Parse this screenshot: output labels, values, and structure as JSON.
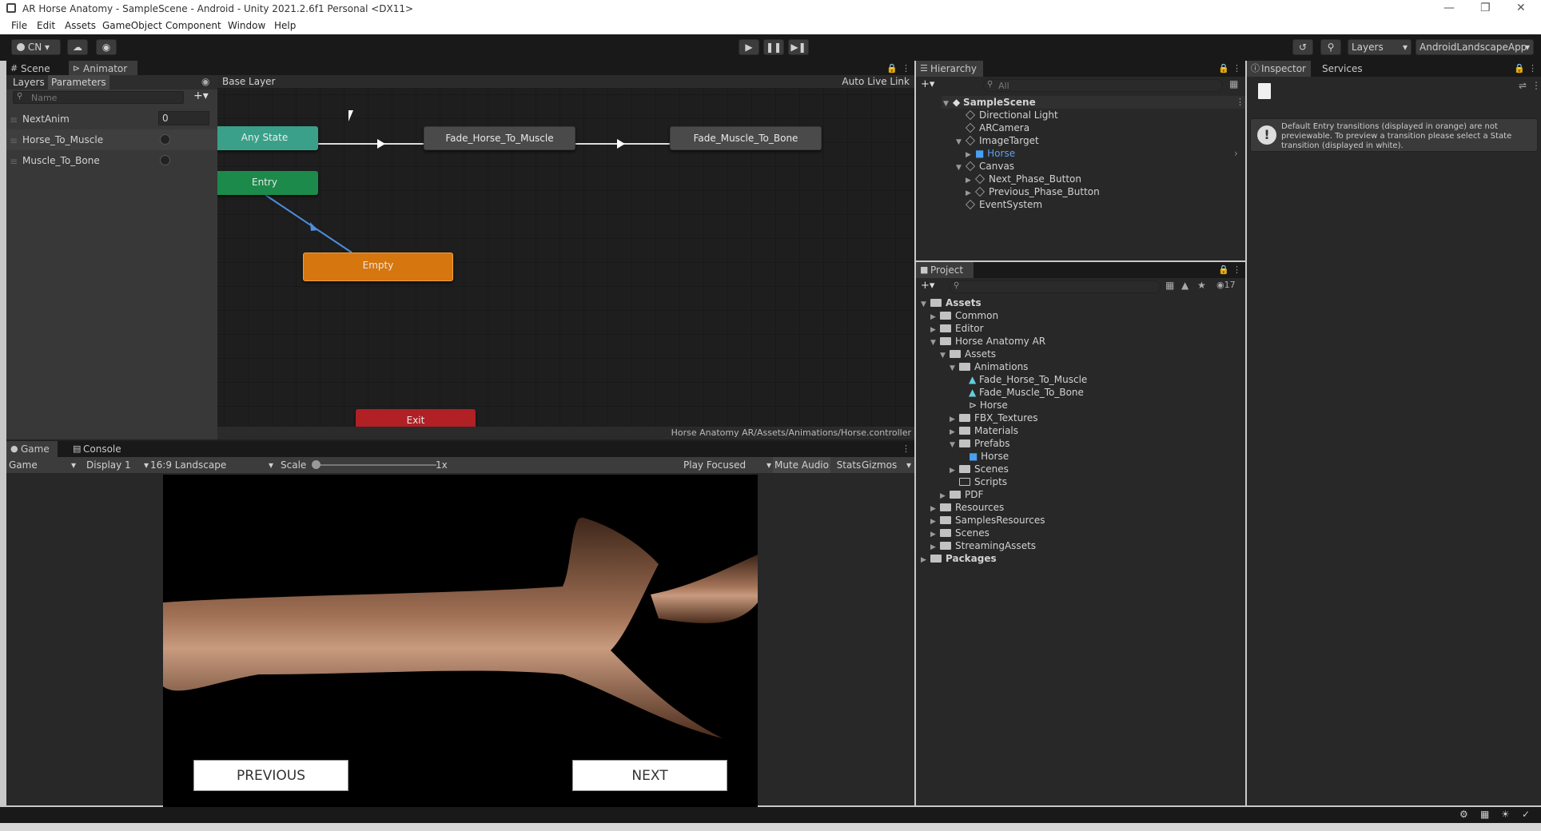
{
  "window": {
    "title": "AR Horse Anatomy - SampleScene - Android - Unity 2021.2.6f1 Personal <DX11>"
  },
  "menu": [
    "File",
    "Edit",
    "Assets",
    "GameObject",
    "Component",
    "Window",
    "Help"
  ],
  "toolbar": {
    "account": "CN",
    "layers": "Layers",
    "layout": "AndroidLandscapeApp"
  },
  "animator": {
    "tabs": {
      "scene": "Scene",
      "animator": "Animator"
    },
    "subtabs": {
      "layers": "Layers",
      "parameters": "Parameters"
    },
    "search_placeholder": "Name",
    "breadcrumb": "Base Layer",
    "auto_live_link": "Auto Live Link",
    "path": "Horse Anatomy AR/Assets/Animations/Horse.controller",
    "parameters": [
      {
        "name": "NextAnim",
        "value": "0"
      },
      {
        "name": "Horse_To_Muscle"
      },
      {
        "name": "Muscle_To_Bone"
      }
    ],
    "states": {
      "any": "Any State",
      "entry": "Entry",
      "empty": "Empty",
      "exit": "Exit",
      "s1": "Fade_Horse_To_Muscle",
      "s2": "Fade_Muscle_To_Bone"
    }
  },
  "game": {
    "tabs": {
      "game": "Game",
      "console": "Console"
    },
    "view": "Game",
    "display": "Display 1",
    "aspect": "16:9 Landscape",
    "scale_label": "Scale",
    "scale_value": "1x",
    "play_focused": "Play Focused",
    "mute": "Mute Audio",
    "stats": "Stats",
    "gizmos": "Gizmos",
    "previous": "PREVIOUS",
    "next": "NEXT"
  },
  "hierarchy": {
    "tab": "Hierarchy",
    "search": "All",
    "items": {
      "scene": "SampleScene",
      "light": "Directional Light",
      "camera": "ARCamera",
      "target": "ImageTarget",
      "horse": "Horse",
      "canvas": "Canvas",
      "next": "Next_Phase_Button",
      "prev": "Previous_Phase_Button",
      "events": "EventSystem"
    }
  },
  "project": {
    "tab": "Project",
    "count": "17",
    "items": {
      "assets": "Assets",
      "common": "Common",
      "editor": "Editor",
      "har": "Horse Anatomy AR",
      "assets2": "Assets",
      "animations": "Animations",
      "a1": "Fade_Horse_To_Muscle",
      "a2": "Fade_Muscle_To_Bone",
      "a3": "Horse",
      "fbx": "FBX_Textures",
      "materials": "Materials",
      "prefabs": "Prefabs",
      "horse": "Horse",
      "scenes": "Scenes",
      "scripts": "Scripts",
      "pdf": "PDF",
      "resources": "Resources",
      "samples": "SamplesResources",
      "scenes2": "Scenes",
      "streaming": "StreamingAssets",
      "packages": "Packages"
    }
  },
  "inspector": {
    "tab": "Inspector",
    "services": "Services",
    "message": "Default Entry transitions (displayed in orange) are not previewable. To preview a transition please select a State transition (displayed in white)."
  }
}
